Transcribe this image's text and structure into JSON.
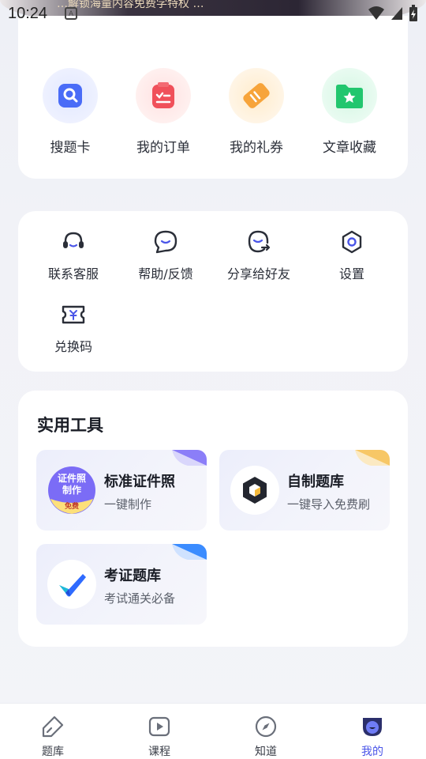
{
  "status_bar": {
    "time": "10:24",
    "notification_glyph": "A"
  },
  "banner": {
    "text": "…解锁海量内容免费学特权 …"
  },
  "quick_actions": [
    {
      "label": "搜题卡",
      "icon": "search-card-icon",
      "color": "#4a6cf7"
    },
    {
      "label": "我的订单",
      "icon": "order-icon",
      "color": "#f0505a"
    },
    {
      "label": "我的礼券",
      "icon": "coupon-icon",
      "color": "#f7a43a"
    },
    {
      "label": "文章收藏",
      "icon": "folder-star-icon",
      "color": "#22c66e"
    }
  ],
  "services": [
    {
      "label": "联系客服",
      "icon": "headset-icon"
    },
    {
      "label": "帮助/反馈",
      "icon": "chat-bubble-icon"
    },
    {
      "label": "分享给好友",
      "icon": "share-friend-icon"
    },
    {
      "label": "设置",
      "icon": "hexagon-settings-icon"
    },
    {
      "label": "兑换码",
      "icon": "redeem-ticket-icon"
    }
  ],
  "tools": {
    "title": "实用工具",
    "items": [
      {
        "name": "标准证件照",
        "desc": "一键制作",
        "logo_line1": "证件照",
        "logo_line2": "制作",
        "logo_badge": "免费",
        "accent": "#7b6cf6"
      },
      {
        "name": "自制题库",
        "desc": "一键导入免费刷",
        "accent": "#f7c766"
      },
      {
        "name": "考证题库",
        "desc": "考试通关必备",
        "accent": "#3b8cff"
      }
    ]
  },
  "bottom_nav": [
    {
      "label": "题库",
      "icon": "pencil-tag-icon"
    },
    {
      "label": "课程",
      "icon": "play-icon"
    },
    {
      "label": "知道",
      "icon": "compass-icon"
    },
    {
      "label": "我的",
      "icon": "profile-icon",
      "active": true
    }
  ],
  "colors": {
    "accent": "#4a55e8",
    "text": "#2a2e38",
    "card": "#ffffff"
  }
}
